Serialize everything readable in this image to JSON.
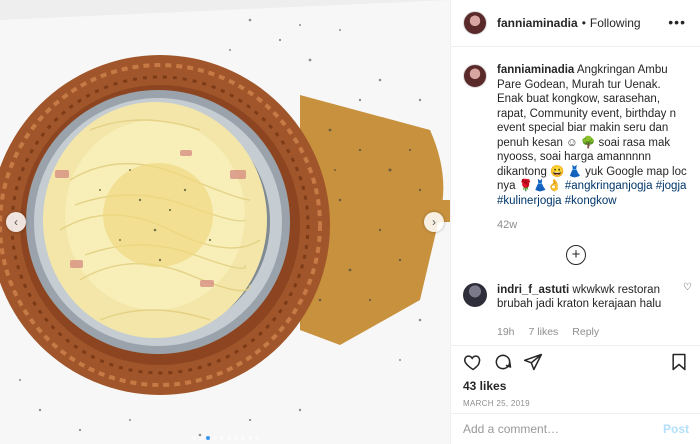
{
  "post": {
    "username": "fanniaminadia",
    "separator": "•",
    "follow_status": "Following",
    "more_icon": "more-options-icon"
  },
  "caption": {
    "username": "fanniaminadia",
    "text": " Angkringan Ambu Pare Godean, Murah tur Uenak. Enak buat kongkow, sarasehan, rapat, Community event, birthday n event special biar makin seru dan penuh kesan ☺ 🌳 soai rasa mak nyooss, soai harga amannnnn dikantong 😀 👗 yuk Google map loc nya 🌹👗👌 ",
    "hashtags": [
      "#angkringanjogja",
      "#jogja",
      "#kulinerjogja",
      "#kongkow"
    ],
    "age": "42w"
  },
  "comment": {
    "username": "indri_f_astuti",
    "text": " wkwkwk restoran brubah jadi kraton kerajaan halu",
    "age": "19h",
    "likes": "7 likes",
    "reply": "Reply"
  },
  "actions": {
    "likes": "43 likes",
    "date": "MARCH 25, 2019"
  },
  "comment_input": {
    "placeholder": "Add a comment…",
    "post_label": "Post"
  },
  "icons": [
    "heart-icon",
    "comment-icon",
    "share-icon",
    "bookmark-icon",
    "plus-circle-icon",
    "chevron-left-icon",
    "chevron-right-icon"
  ],
  "colors": {
    "link": "#003569",
    "post_disabled": "#b2dffc",
    "muted": "#8e8e8e",
    "dot_active": "#3897f0"
  }
}
